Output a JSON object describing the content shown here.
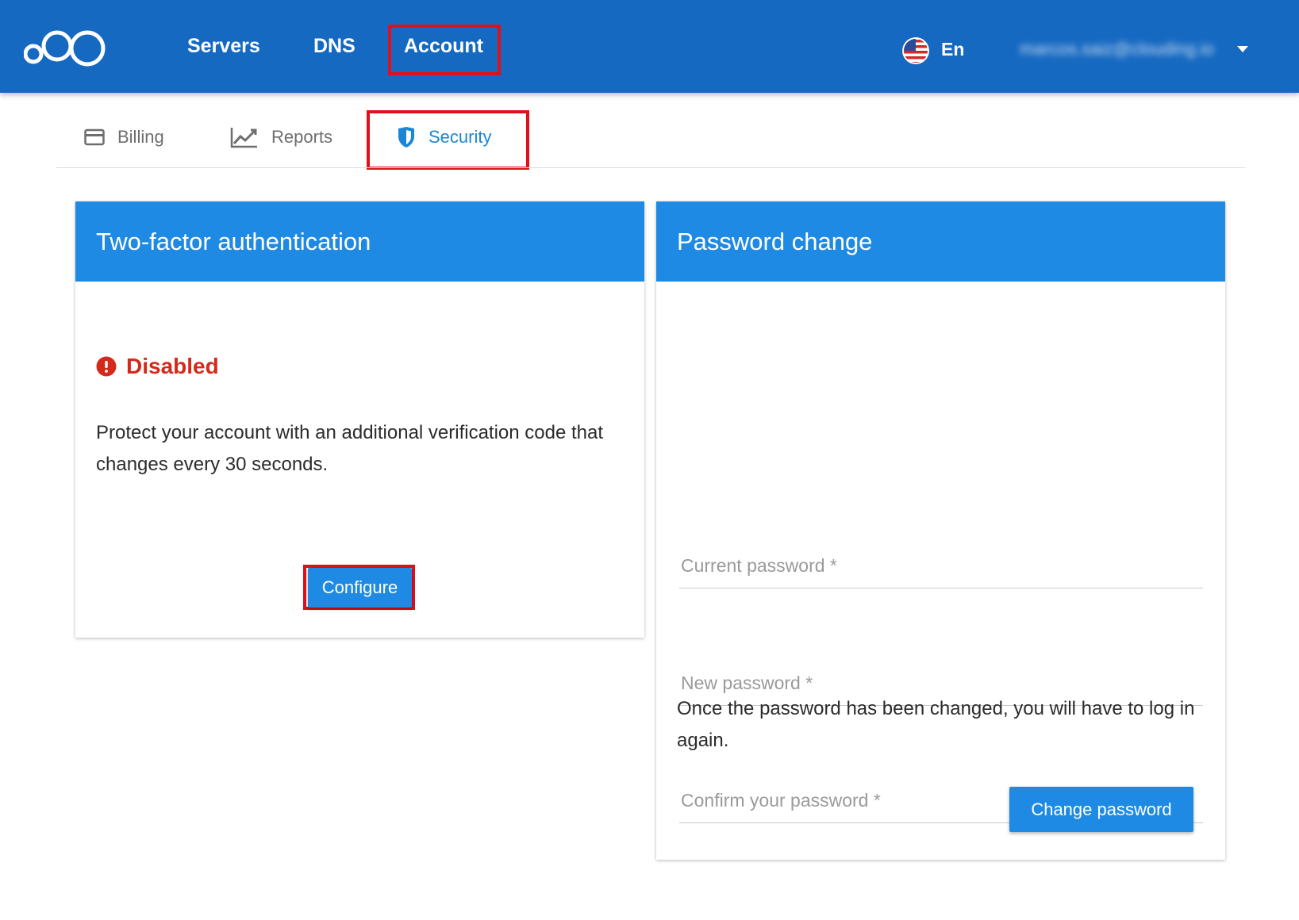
{
  "topbar": {
    "nav": [
      "Servers",
      "DNS",
      "Account"
    ],
    "language": "En",
    "user_email": "marcos.saiz@clouding.io",
    "colors": {
      "bar": "#1669c1",
      "highlight": "#e0101a"
    }
  },
  "tabs": [
    {
      "label": "Billing",
      "icon": "credit-card-icon"
    },
    {
      "label": "Reports",
      "icon": "trending-up-icon"
    },
    {
      "label": "Security",
      "icon": "shield-icon",
      "active": true
    }
  ],
  "two_factor": {
    "title": "Two-factor authentication",
    "status": "Disabled",
    "description": "Protect your account with an additional verification code that changes every 30 seconds.",
    "button": "Configure"
  },
  "password_change": {
    "title": "Password change",
    "fields": {
      "current": "Current password *",
      "new": "New password *",
      "confirm": "Confirm your password *"
    },
    "note": "Once the password has been changed, you will have to log in again.",
    "button": "Change password"
  },
  "colors": {
    "accent": "#1f8ae3",
    "error": "#d42a1c"
  }
}
